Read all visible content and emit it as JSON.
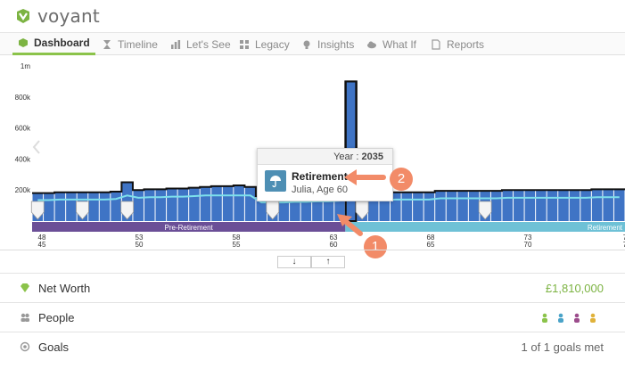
{
  "app": {
    "name": "voyant",
    "brand_color": "#7cb342"
  },
  "tabs": [
    {
      "label": "Dashboard",
      "icon": "cube-icon",
      "active": true
    },
    {
      "label": "Timeline",
      "icon": "hourglass-icon",
      "active": false
    },
    {
      "label": "Let's See",
      "icon": "bars-icon",
      "active": false
    },
    {
      "label": "Legacy",
      "icon": "tree-icon",
      "active": false
    },
    {
      "label": "Insights",
      "icon": "lightbulb-icon",
      "active": false
    },
    {
      "label": "What If",
      "icon": "cloud-icon",
      "active": false
    },
    {
      "label": "Reports",
      "icon": "document-icon",
      "active": false
    }
  ],
  "chart_data": {
    "type": "bar",
    "y_tick_labels": [
      "1m",
      "800k",
      "600k",
      "400k",
      "200k"
    ],
    "ylim": [
      0,
      1000000
    ],
    "x_start_year": 2020,
    "ages_top": [
      "48",
      "53",
      "58",
      "63",
      "68",
      "73",
      "7"
    ],
    "ages_bottom": [
      "45",
      "50",
      "55",
      "60",
      "65",
      "70",
      "7"
    ],
    "values": [
      180000,
      180000,
      185000,
      185000,
      185000,
      185000,
      185000,
      190000,
      250000,
      200000,
      205000,
      205000,
      210000,
      210000,
      215000,
      220000,
      225000,
      225000,
      230000,
      220000,
      160000,
      160000,
      160000,
      165000,
      165000,
      170000,
      170000,
      175000,
      900000,
      180000,
      180000,
      180000,
      185000,
      185000,
      185000,
      185000,
      195000,
      195000,
      195000,
      195000,
      195000,
      195000,
      200000,
      200000,
      200000,
      200000,
      200000,
      200000,
      200000,
      200000,
      205000,
      205000,
      205000
    ],
    "phases": [
      {
        "label": "Pre-Retirement",
        "color": "#6b4f97"
      },
      {
        "label": "Retirement",
        "color": "#6ec1d6"
      }
    ],
    "bar_color": "#3f74c5",
    "line_color": "#7de0ec",
    "highlight_year": "2035"
  },
  "tooltip": {
    "year_label": "Year :",
    "year": "2035",
    "title": "Retirement",
    "subtitle": "Julia, Age 60"
  },
  "callouts": [
    "1",
    "2"
  ],
  "controls": {
    "down": "↓",
    "up": "↑"
  },
  "summary": [
    {
      "label": "Net Worth",
      "value": "£1,810,000",
      "icon": "diamond-icon",
      "value_color": "#7cb342"
    },
    {
      "label": "People",
      "value": "",
      "icon": "people-icon",
      "value_color": "#333"
    },
    {
      "label": "Goals",
      "value": "1 of 1 goals met",
      "icon": "target-icon",
      "value_color": "#666"
    }
  ],
  "people_colors": [
    "#8bc34a",
    "#4aa3c8",
    "#9c4d8c",
    "#e0b23a"
  ]
}
